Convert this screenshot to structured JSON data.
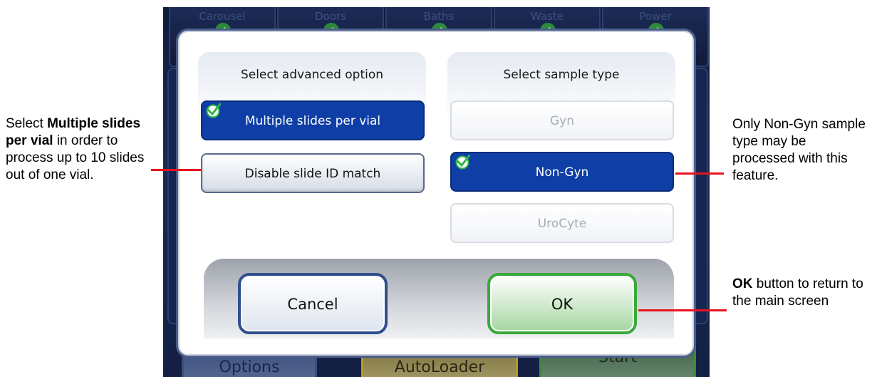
{
  "background": {
    "status_tiles": [
      {
        "label": "Carousel"
      },
      {
        "label": "Doors"
      },
      {
        "label": "Baths"
      },
      {
        "label": "Waste"
      },
      {
        "label": "Power"
      }
    ],
    "bottom_buttons": {
      "options": "Options",
      "autoloader": "AutoLoader",
      "start": "Start"
    }
  },
  "dialog": {
    "left_panel": {
      "title": "Select advanced option",
      "options": [
        {
          "label": "Multiple slides per vial",
          "state": "selected"
        },
        {
          "label": "Disable slide ID match",
          "state": "normal"
        }
      ]
    },
    "right_panel": {
      "title": "Select sample type",
      "options": [
        {
          "label": "Gyn",
          "state": "disabled"
        },
        {
          "label": "Non-Gyn",
          "state": "selected"
        },
        {
          "label": "UroCyte",
          "state": "disabled"
        }
      ]
    },
    "cancel_label": "Cancel",
    "ok_label": "OK"
  },
  "callouts": {
    "left": {
      "prefix": "Select ",
      "bold": "Multiple slides per vial",
      "suffix": " in order to process up to 10 slides out of one vial."
    },
    "right_top": {
      "text": "Only Non-Gyn sample type may be processed with this feature."
    },
    "right_bottom": {
      "bold": "OK",
      "suffix": " button to return to the main screen"
    }
  },
  "colors": {
    "selected_blue": "#0f3fa6",
    "ok_green": "#3aa93a",
    "cancel_blue": "#2f4f8d",
    "leader_red": "#e8131e",
    "check_green": "#2db54a"
  }
}
